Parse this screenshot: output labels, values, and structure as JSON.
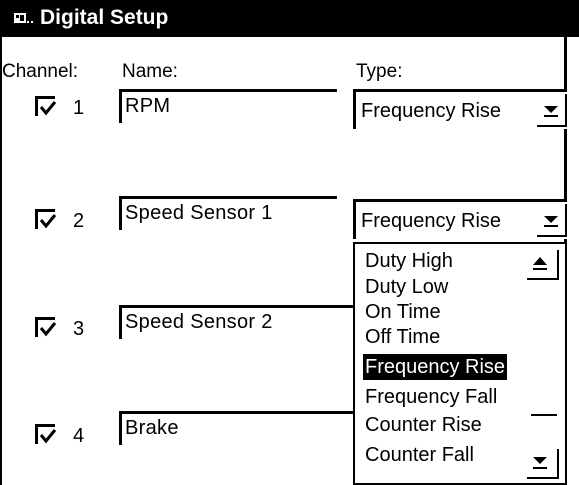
{
  "window": {
    "title": "Digital Setup",
    "icon": "window-icon"
  },
  "headers": {
    "channel": "Channel:",
    "name": "Name:",
    "type": "Type:"
  },
  "channels": [
    {
      "number": "1",
      "checked": true,
      "name": "RPM",
      "type": "Frequency Rise"
    },
    {
      "number": "2",
      "checked": true,
      "name": "Speed Sensor 1",
      "type": "Frequency Rise"
    },
    {
      "number": "3",
      "checked": true,
      "name": "Speed Sensor 2",
      "type": ""
    },
    {
      "number": "4",
      "checked": true,
      "name": "Brake",
      "type": ""
    }
  ],
  "dropdown": {
    "options": [
      "Duty High",
      "Duty Low",
      "On Time",
      "Off Time",
      "Frequency Rise",
      "Frequency Fall",
      "Counter Rise",
      "Counter Fall"
    ],
    "selected": "Frequency Rise"
  }
}
